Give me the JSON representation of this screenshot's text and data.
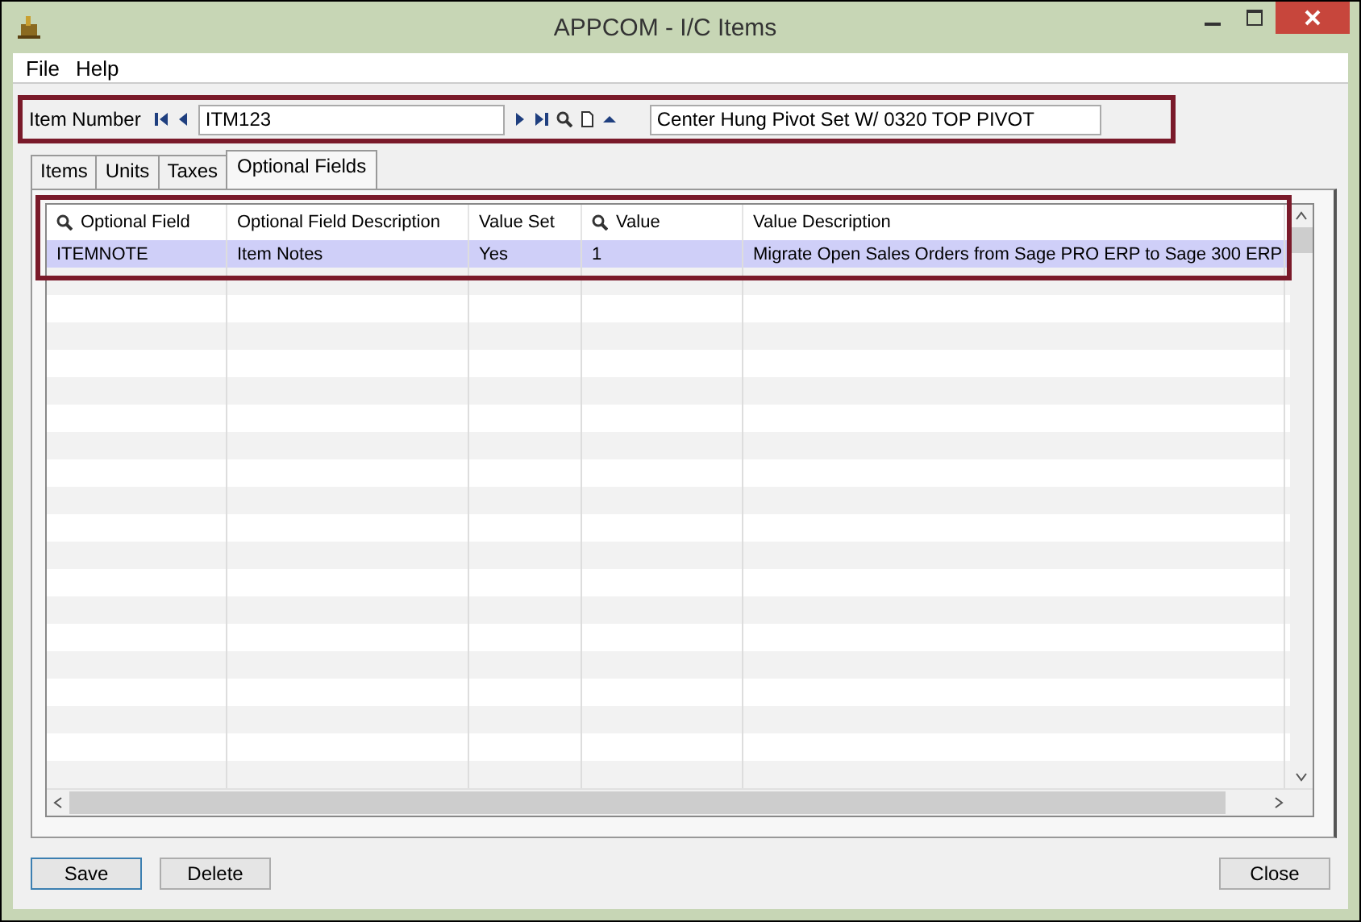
{
  "window": {
    "title": "APPCOM - I/C Items"
  },
  "menu": [
    "File",
    "Help"
  ],
  "item_number": {
    "label": "Item Number",
    "value": "ITM123",
    "description": "Center Hung Pivot Set W/ 0320 TOP PIVOT"
  },
  "tabs": [
    {
      "label": "Items",
      "selected": false
    },
    {
      "label": "Units",
      "selected": false
    },
    {
      "label": "Taxes",
      "selected": false
    },
    {
      "label": "Optional Fields",
      "selected": true
    }
  ],
  "table": {
    "columns": [
      {
        "label": "Optional Field",
        "lookup": true
      },
      {
        "label": "Optional Field Description",
        "lookup": false
      },
      {
        "label": "Value Set",
        "lookup": false
      },
      {
        "label": "Value",
        "lookup": true
      },
      {
        "label": "Value Description",
        "lookup": false
      }
    ],
    "rows": [
      {
        "selected": true,
        "cells": [
          "ITEMNOTE",
          "Item Notes",
          "Yes",
          "1",
          "Migrate Open Sales Orders from Sage PRO ERP to Sage 300 ERP"
        ]
      }
    ]
  },
  "buttons": [
    {
      "label": "Save",
      "default": true
    },
    {
      "label": "Delete",
      "default": false
    },
    {
      "label": "Close",
      "default": false
    }
  ]
}
